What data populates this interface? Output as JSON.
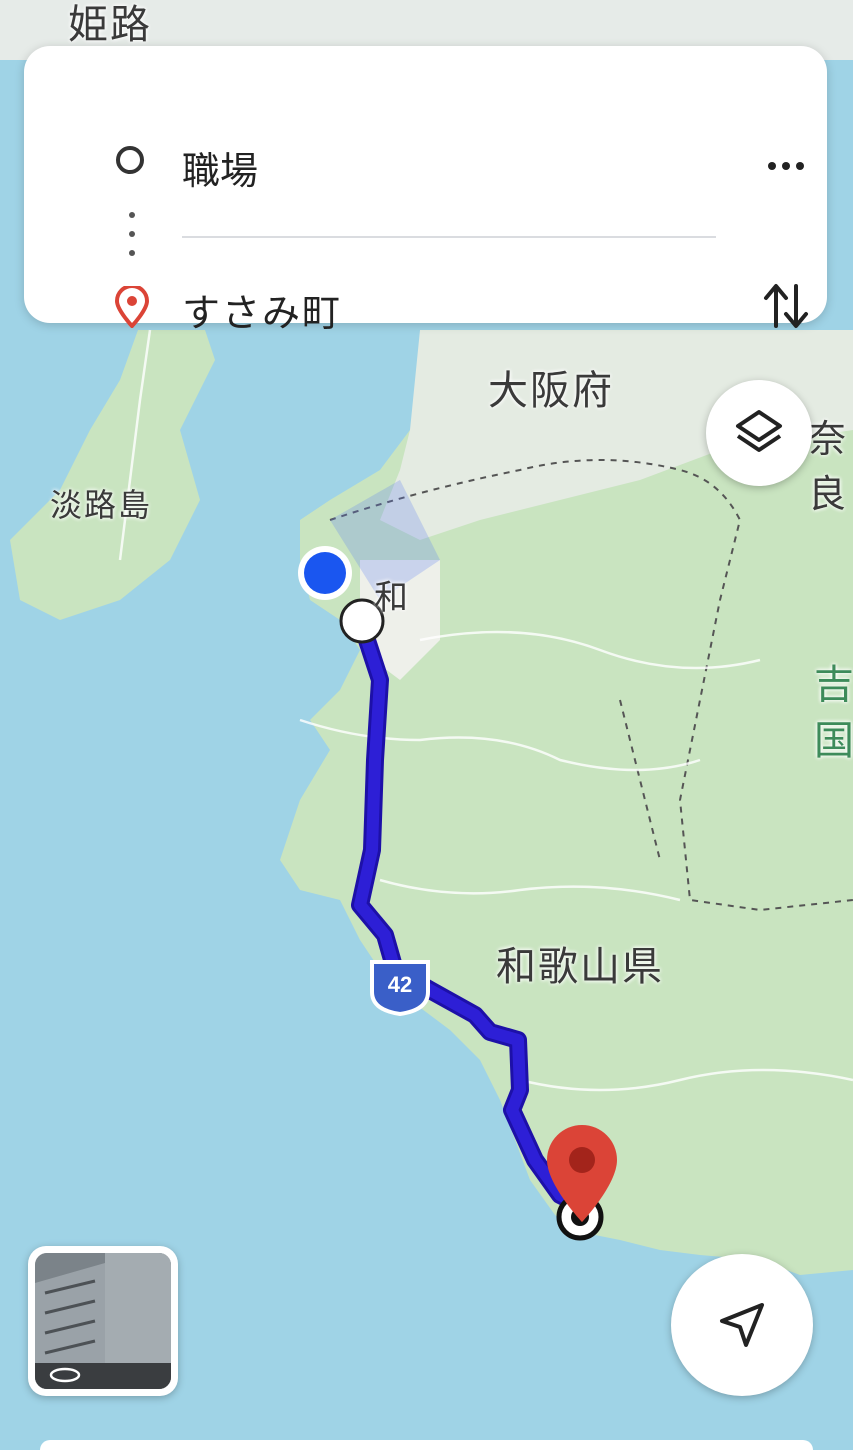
{
  "route_card": {
    "origin": "職場",
    "destination": "すさみ町"
  },
  "map": {
    "labels": {
      "himeji": "姫路",
      "osaka": "大阪府",
      "awaji": "淡路島",
      "wakayama_pref": "和歌山県",
      "nara": "奈良",
      "yoshino": "吉",
      "kuni": "国",
      "wa": "和"
    },
    "route_shield": "42",
    "colors": {
      "route": "#2d1fd6",
      "route_outline": "#1d10a8",
      "current_location": "#1a56f0",
      "destination_pin": "#db4437",
      "land": "#e4eedf",
      "green": "#c9e4c0",
      "water": "#9fd3e6",
      "shield": "#3a5fc8"
    }
  }
}
